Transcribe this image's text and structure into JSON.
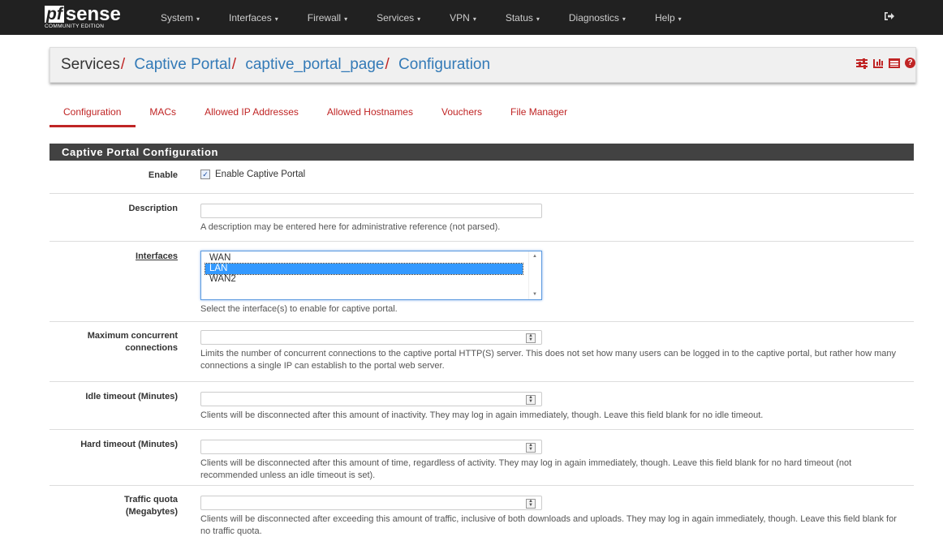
{
  "brand": {
    "logo_pf": "pf",
    "logo_sense": "sense",
    "edition": "COMMUNITY EDITION"
  },
  "nav": {
    "items": [
      {
        "label": "System"
      },
      {
        "label": "Interfaces"
      },
      {
        "label": "Firewall"
      },
      {
        "label": "Services"
      },
      {
        "label": "VPN"
      },
      {
        "label": "Status"
      },
      {
        "label": "Diagnostics"
      },
      {
        "label": "Help"
      }
    ],
    "caret": "▾",
    "logout_icon": "logout-icon"
  },
  "breadcrumb": {
    "root": "Services",
    "sep": "/",
    "items": [
      "Captive Portal",
      "captive_portal_page",
      "Configuration"
    ]
  },
  "tabs": [
    {
      "label": "Configuration",
      "active": true
    },
    {
      "label": "MACs"
    },
    {
      "label": "Allowed IP Addresses"
    },
    {
      "label": "Allowed Hostnames"
    },
    {
      "label": "Vouchers"
    },
    {
      "label": "File Manager"
    }
  ],
  "panel": {
    "title": "Captive Portal Configuration",
    "enable": {
      "label": "Enable",
      "checkbox_label": "Enable Captive Portal",
      "checked": true,
      "check_glyph": "✓"
    },
    "description": {
      "label": "Description",
      "value": "",
      "help": "A description may be entered here for administrative reference (not parsed)."
    },
    "interfaces": {
      "label": "Interfaces",
      "options": [
        "WAN",
        "LAN",
        "WAN2"
      ],
      "selected": "LAN",
      "help": "Select the interface(s) to enable for captive portal."
    },
    "max_conn": {
      "label_1": "Maximum concurrent",
      "label_2": "connections",
      "value": "",
      "help": "Limits the number of concurrent connections to the captive portal HTTP(S) server. This does not set how many users can be logged in to the captive portal, but rather how many connections a single IP can establish to the portal web server."
    },
    "idle_timeout": {
      "label": "Idle timeout (Minutes)",
      "value": "",
      "help": "Clients will be disconnected after this amount of inactivity. They may log in again immediately, though. Leave this field blank for no idle timeout."
    },
    "hard_timeout": {
      "label": "Hard timeout (Minutes)",
      "value": "",
      "help": "Clients will be disconnected after this amount of time, regardless of activity. They may log in again immediately, though. Leave this field blank for no hard timeout (not recommended unless an idle timeout is set)."
    },
    "traffic_quota": {
      "label_1": "Traffic quota",
      "label_2": "(Megabytes)",
      "value": "",
      "help": "Clients will be disconnected after exceeding this amount of traffic, inclusive of both downloads and uploads. They may log in again immediately, though. Leave this field blank for no traffic quota."
    }
  },
  "colors": {
    "accent": "#c02525",
    "link": "#337ab7",
    "navbar": "#212121",
    "panel_head": "#424242",
    "selection": "#3399ff"
  }
}
